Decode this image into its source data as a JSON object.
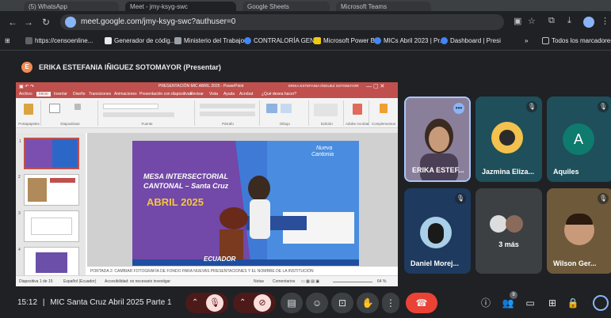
{
  "browser": {
    "tabs": [
      "(5) WhatsApp",
      "Meet - jmy-ksyg-swc",
      "Google Sheets",
      "Microsoft Teams"
    ],
    "url": "meet.google.com/jmy-ksyg-swc?authuser=0",
    "bookmarks": [
      "https://censoenline...",
      "Generador de códig...",
      "Ministerio del Trabajo",
      "CONTRALORÍA GEN...",
      "Microsoft Power BI",
      "MICs Abril 2023 | Pr...",
      "Dashboard | Presi"
    ],
    "bookmarks_more": "»",
    "all_bookmarks": "Todos los marcadores"
  },
  "meet": {
    "presenter_initial": "E",
    "presenter_label": "ERIKA ESTEFANIA IÑIGUEZ SOTOMAYOR (Presentar)",
    "time": "15:12",
    "meeting_name": "MIC Santa Cruz Abril 2025 Parte 1",
    "participants_badge": "9",
    "tiles": [
      {
        "name": "ERIKA ESTEF..."
      },
      {
        "name": "Jazmina Eliza..."
      },
      {
        "name": "Aquiles",
        "initial": "A"
      },
      {
        "name": "Daniel Morej..."
      },
      {
        "name": "3 más"
      },
      {
        "name": "Wilson Ger..."
      }
    ]
  },
  "powerpoint": {
    "title": "PRESENTACIÓN MIC ABRIL 2025 - PowerPoint",
    "user": "ERIKA ESTEFANIA IÑIGUEZ SOTOMAYOR",
    "search": "¿Qué desea hacer?",
    "menu": [
      "Archivo",
      "Inicio",
      "Insertar",
      "Diseño",
      "Transiciones",
      "Animaciones",
      "Presentación con diapositivas",
      "Revisar",
      "Vista",
      "Ayuda",
      "Acrobat"
    ],
    "ribbon_groups": [
      "Portapapeles",
      "Diapositivas",
      "Fuente",
      "Párrafo",
      "Dibujo",
      "Edición",
      "Adobe Acrobat",
      "Complementos"
    ],
    "slide_numbers": [
      "1",
      "2",
      "3",
      "4"
    ],
    "slide": {
      "title1": "MESA INTERSECTORIAL",
      "title2": "CANTONAL – Santa Cruz",
      "month": "ABRIL 2025",
      "brand1": "Nueva",
      "brand2": "Cantonia",
      "logo": "ECUADOR"
    },
    "notes": "PORTADA 2: CAMBIAR FOTOGRAFÍA DE FONDO PARA NUEVAS PRESENTACIONES Y EL NOMBRE DE LA INSTITUCIÓN",
    "status_slide": "Diapositiva 1 de 15",
    "status_lang": "Español (Ecuador)",
    "status_access": "Accesibilidad: es necesario investigar",
    "status_notes": "Notas",
    "status_comments": "Comentarios",
    "zoom": "64 %"
  },
  "colors": {
    "ppt_red": "#c0504d",
    "leave_red": "#ea4335",
    "meet_bg": "#202124"
  }
}
